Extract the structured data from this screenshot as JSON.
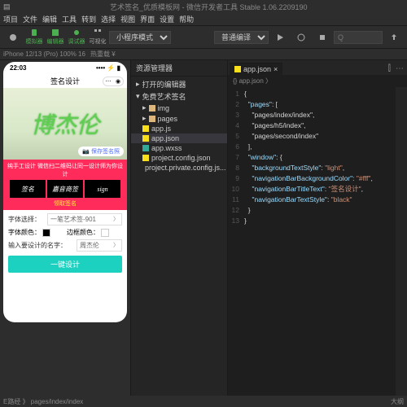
{
  "titlebar": {
    "title": "艺术签名_优质模板网",
    "app": "微信开发者工具 Stable 1.06.2209190"
  },
  "menubar": [
    "项目",
    "文件",
    "编辑",
    "工具",
    "转到",
    "选择",
    "视图",
    "界面",
    "设置",
    "帮助"
  ],
  "toolbar": {
    "buttons": [
      {
        "name": "simulator",
        "label": "模拟器"
      },
      {
        "name": "editor",
        "label": "编辑器"
      },
      {
        "name": "debugger",
        "label": "调试器"
      },
      {
        "name": "visual",
        "label": "可视化"
      }
    ],
    "mode": "小程序模式",
    "compile": "普通编译",
    "search_ph": "Q"
  },
  "devbar": {
    "device": "iPhone 12/13 (Pro) 100% 16",
    "hot": "热重载 ¥"
  },
  "phone": {
    "time": "22:03",
    "title": "签名设计",
    "save_btn": "保存签名照",
    "promo_title": "纯手工设计 微信扫二维码让同一设计师为你设计",
    "promo_link": "领取签名",
    "promo_sub": "嘉音商签",
    "font_label": "字体选择：",
    "font_value": "一笔艺术签-901",
    "color_label": "字体颜色：",
    "border_label": "边框颜色：",
    "name_label": "输入要设计的名字：",
    "name_value": "周杰伦",
    "gen_btn": "一键设计"
  },
  "explorer": {
    "title": "资源管理器",
    "open_editors": "打开的编辑器",
    "root": "免费艺术签名",
    "items": [
      {
        "label": "img",
        "type": "folder",
        "depth": 1
      },
      {
        "label": "pages",
        "type": "folder",
        "depth": 1
      },
      {
        "label": "app.js",
        "type": "js",
        "depth": 1
      },
      {
        "label": "app.json",
        "type": "json",
        "depth": 1,
        "selected": true
      },
      {
        "label": "app.wxss",
        "type": "wxss",
        "depth": 1
      },
      {
        "label": "project.config.json",
        "type": "json",
        "depth": 1
      },
      {
        "label": "project.private.config.js...",
        "type": "json",
        "depth": 1
      }
    ]
  },
  "editor": {
    "tab": "app.json",
    "lines": [
      "{",
      "  \"pages\": [",
      "    \"pages/index/index\",",
      "    \"pages/h5/index\",",
      "    \"pages/second/index\"",
      "  ],",
      "  \"window\": {",
      "    \"backgroundTextStyle\": \"light\",",
      "    \"navigationBarBackgroundColor\": \"#fff\",",
      "    \"navigationBarTitleText\": \"签名设计\",",
      "    \"navigationBarTextStyle\": \"black\"",
      "  }",
      "}"
    ]
  },
  "bottom": {
    "path": "E路经 》 pages/index/index",
    "outline": "大纲"
  }
}
